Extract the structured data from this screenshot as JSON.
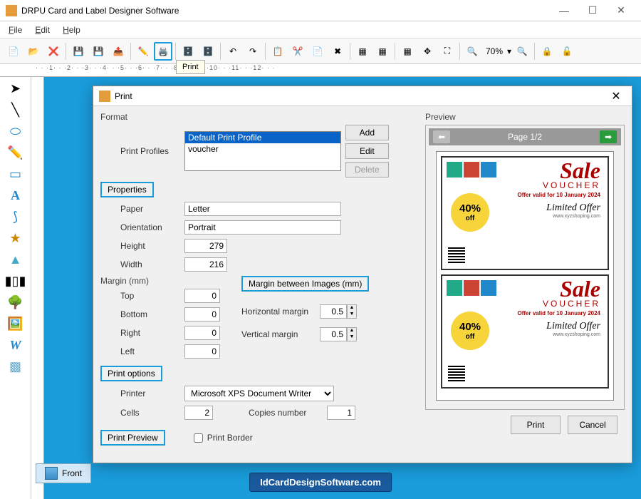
{
  "window": {
    "title": "DRPU Card and Label Designer Software",
    "minimize": "—",
    "maximize": "☐",
    "close": "✕"
  },
  "menu": {
    "file": "File",
    "edit": "Edit",
    "help": "Help"
  },
  "toolbar": {
    "zoom": "70%",
    "tooltip": "Print"
  },
  "dialog": {
    "title": "Print",
    "close": "✕",
    "format_label": "Format",
    "profiles_label": "Print Profiles",
    "profiles": {
      "selected": "Default Print Profile",
      "other": "voucher"
    },
    "add": "Add",
    "edit": "Edit",
    "delete": "Delete",
    "properties_label": "Properties",
    "paper_label": "Paper",
    "paper_value": "Letter",
    "orientation_label": "Orientation",
    "orientation_value": "Portrait",
    "height_label": "Height",
    "height_value": "279",
    "width_label": "Width",
    "width_value": "216",
    "margin_label": "Margin (mm)",
    "top_label": "Top",
    "top_value": "0",
    "bottom_label": "Bottom",
    "bottom_value": "0",
    "right_label": "Right",
    "right_value": "0",
    "left_label": "Left",
    "left_value": "0",
    "margin_between_label": "Margin between Images (mm)",
    "hmargin_label": "Horizontal margin",
    "hmargin_value": "0.5",
    "vmargin_label": "Vertical margin",
    "vmargin_value": "0.5",
    "print_options_label": "Print options",
    "printer_label": "Printer",
    "printer_value": "Microsoft XPS Document Writer",
    "cells_label": "Cells",
    "cells_value": "2",
    "copies_label": "Copies number",
    "copies_value": "1",
    "preview_btn": "Print Preview",
    "border_label": "Print Border",
    "print": "Print",
    "cancel": "Cancel"
  },
  "preview": {
    "label": "Preview",
    "page": "Page 1/2",
    "prev": "⬅",
    "next": "➡"
  },
  "voucher": {
    "sale": "Sale",
    "voucher": "VOUCHER",
    "pct": "40%",
    "off": "off",
    "offer": "Offer valid for 10 January 2024",
    "limited": "Limited Offer",
    "site": "www.xyzshoping.com"
  },
  "tab": {
    "front": "Front"
  },
  "watermark": "IdCardDesignSoftware.com"
}
